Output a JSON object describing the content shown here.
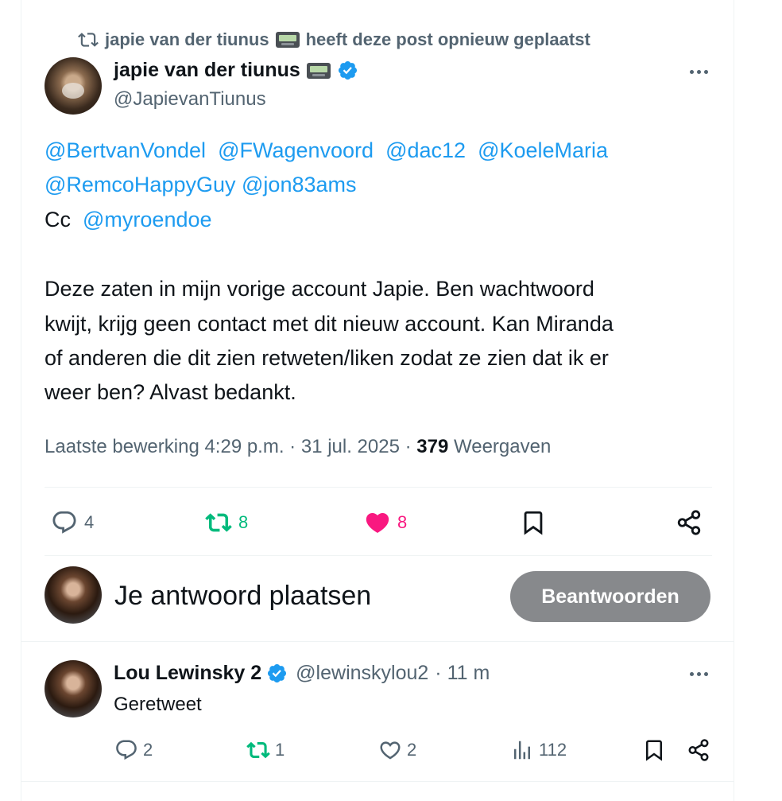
{
  "repost_context": {
    "user": "japie van der tiunus",
    "suffix": "heeft deze post opnieuw geplaatst"
  },
  "post": {
    "author_name": "japie van der tiunus",
    "author_handle": "@JapievanTiunus",
    "mentions_line1": [
      "@BertvanVondel",
      "@FWagenvoord",
      "@dac12",
      "@KoeleMaria"
    ],
    "mentions_line2": [
      "@RemcoHappyGuy",
      "@jon83ams"
    ],
    "cc_label": "Cc",
    "cc_mention": "@myroendoe",
    "body_lines": [
      "Deze zaten in mijn vorige account Japie. Ben wachtwoord",
      "kwijt, krijg geen contact met dit nieuw account.  Kan Miranda",
      "of anderen die dit zien retweten/liken zodat ze zien dat ik er",
      "weer ben? Alvast bedankt."
    ],
    "meta_prefix": "Laatste bewerking 4:29 p.m. · 31 jul. 2025 · ",
    "views_count": "379",
    "views_label": "Weergaven",
    "stats": {
      "replies": "4",
      "reposts": "8",
      "likes": "8"
    }
  },
  "compose": {
    "placeholder": "Je antwoord plaatsen",
    "button_label": "Beantwoorden"
  },
  "reply": {
    "author_name": "Lou Lewinsky 2",
    "author_handle": "@lewinskylou2",
    "time": "· 11 m",
    "text": "Geretweet",
    "stats": {
      "replies": "2",
      "reposts": "1",
      "likes": "2",
      "views": "112"
    }
  },
  "colors": {
    "accent": "#1d9bf0",
    "repost_green": "#00ba7c",
    "like_pink": "#f91880",
    "muted": "#536471",
    "button_gray": "#87898c"
  },
  "icons": [
    "repost-icon",
    "verified-badge-icon",
    "pager-emoji-icon",
    "more-icon",
    "reply-icon",
    "like-icon",
    "bookmark-icon",
    "share-icon",
    "views-icon"
  ]
}
